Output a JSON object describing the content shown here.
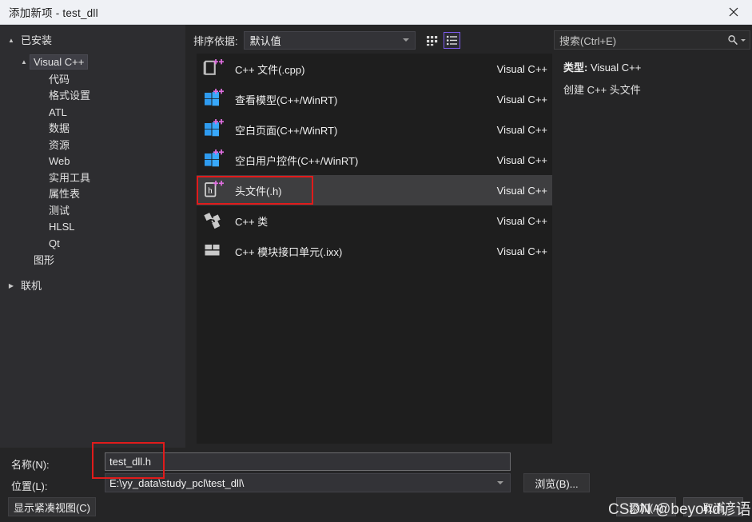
{
  "window": {
    "title": "添加新项 - test_dll",
    "close_icon": "close-icon"
  },
  "tree": {
    "installed_label": "已安装",
    "group_label": "Visual C++",
    "leaves": [
      {
        "label": "代码"
      },
      {
        "label": "格式设置"
      },
      {
        "label": "ATL"
      },
      {
        "label": "数据"
      },
      {
        "label": "资源"
      },
      {
        "label": "Web"
      },
      {
        "label": "实用工具"
      },
      {
        "label": "属性表"
      },
      {
        "label": "测试"
      },
      {
        "label": "HLSL"
      },
      {
        "label": "Qt"
      }
    ],
    "sub_label": "图形",
    "online_label": "联机"
  },
  "toolbar": {
    "sort_label": "排序依据:",
    "sort_value": "默认值",
    "grid_view_icon": "grid-view-icon",
    "list_view_icon": "list-view-icon"
  },
  "templates": [
    {
      "name": "C++ 文件(.cpp)",
      "lang": "Visual C++",
      "icon": "cpp-file-icon",
      "selected": false
    },
    {
      "name": "查看模型(C++/WinRT)",
      "lang": "Visual C++",
      "icon": "winrt-window-icon",
      "selected": false
    },
    {
      "name": "空白页面(C++/WinRT)",
      "lang": "Visual C++",
      "icon": "winrt-window-icon",
      "selected": false
    },
    {
      "name": "空白用户控件(C++/WinRT)",
      "lang": "Visual C++",
      "icon": "winrt-window-icon",
      "selected": false
    },
    {
      "name": "头文件(.h)",
      "lang": "Visual C++",
      "icon": "header-file-icon",
      "selected": true
    },
    {
      "name": "C++ 类",
      "lang": "Visual C++",
      "icon": "cpp-class-icon",
      "selected": false
    },
    {
      "name": "C++ 模块接口单元(.ixx)",
      "lang": "Visual C++",
      "icon": "cpp-module-icon",
      "selected": false
    }
  ],
  "search": {
    "placeholder": "搜索(Ctrl+E)",
    "icon": "search-icon"
  },
  "detail": {
    "type_label": "类型:",
    "type_value": "Visual C++",
    "description": "创建 C++ 头文件"
  },
  "form": {
    "name_label": "名称(N):",
    "name_value": "test_dll.h",
    "location_label": "位置(L):",
    "location_value": "E:\\yy_data\\study_pcl\\test_dll\\",
    "browse_label": "浏览(B)...",
    "compact_label": "显示紧凑视图(C)",
    "add_label": "添加(A)",
    "cancel_label": "取消"
  },
  "watermark": {
    "text": "CSDN @beyond谚语"
  },
  "colors": {
    "titlebar_bg": "#eff1f5",
    "dialog_bg": "#252526",
    "tree_bg": "#2d2d30",
    "list_bg": "#1e1e1e",
    "selection_bg": "#3e3e40",
    "accent": "#7d5bed",
    "annotation": "#e01b1b"
  }
}
